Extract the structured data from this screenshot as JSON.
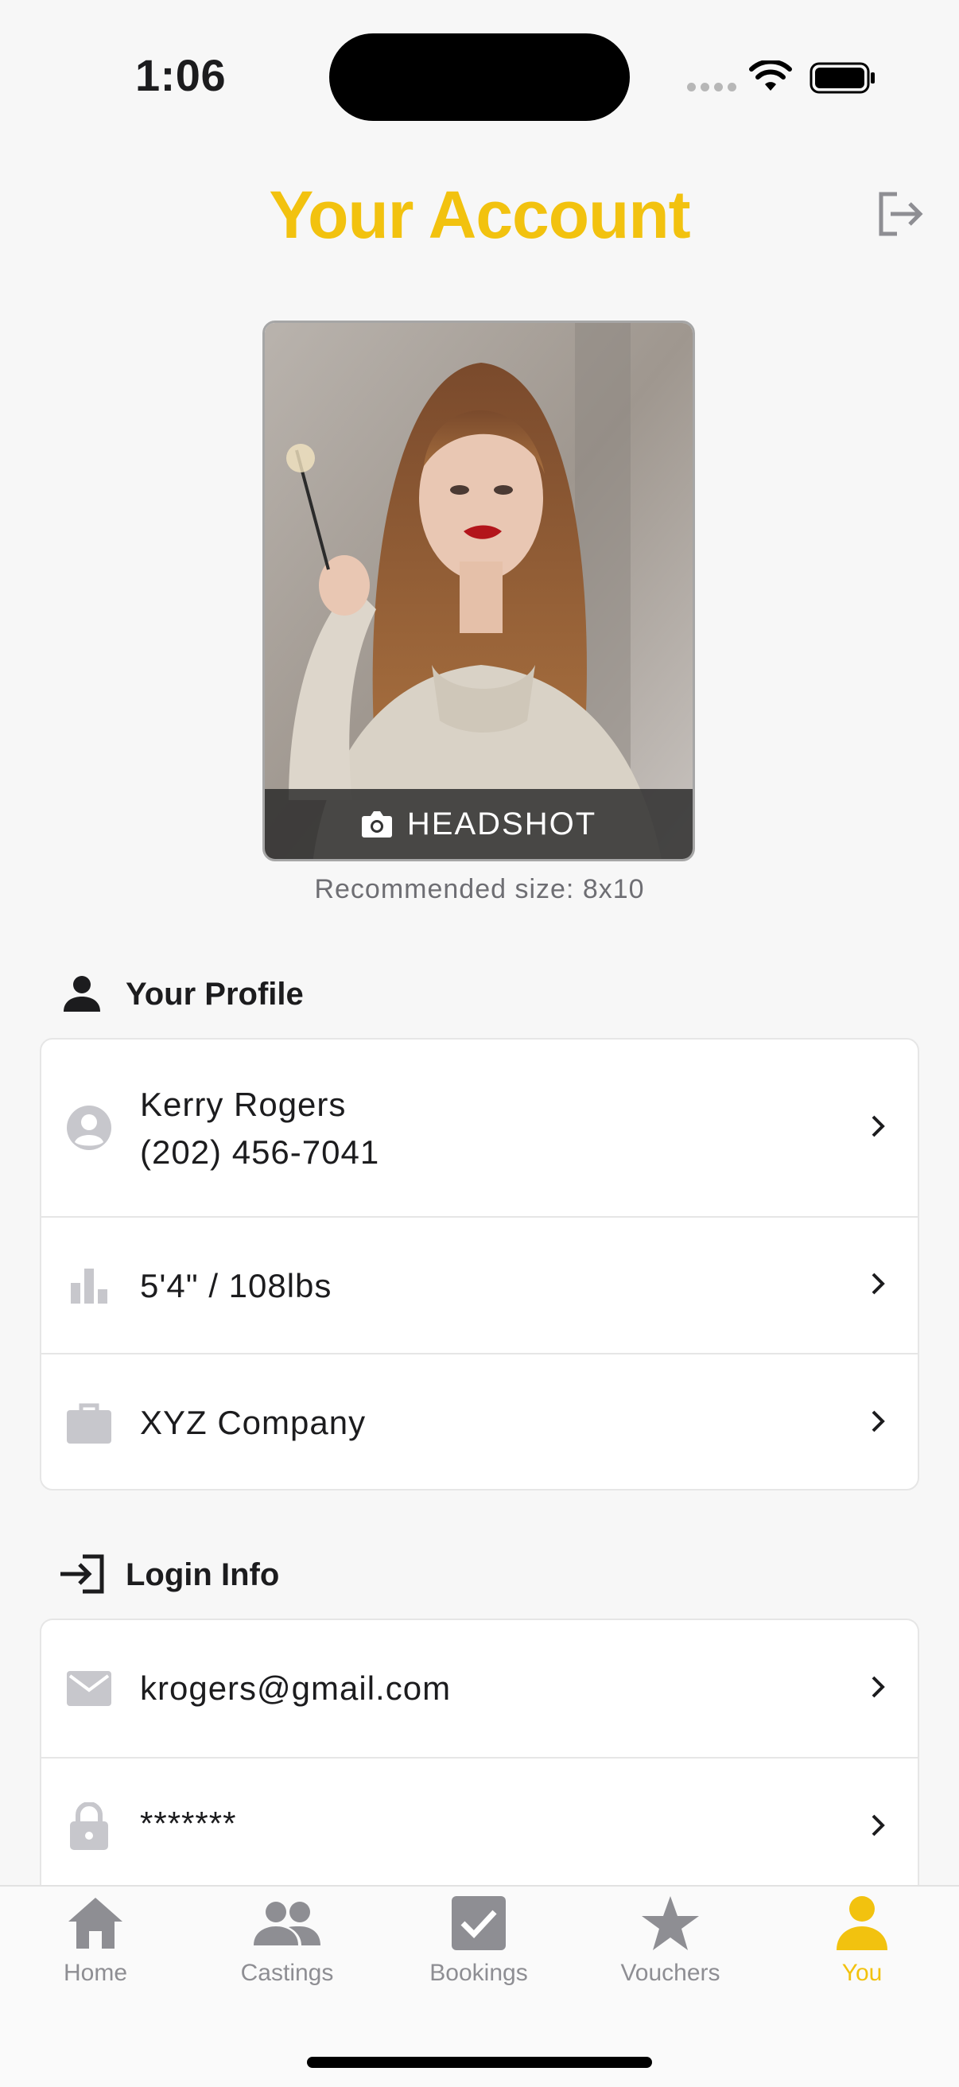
{
  "status_bar": {
    "time": "1:06"
  },
  "header": {
    "title": "Your Account"
  },
  "headshot": {
    "button_label": "HEADSHOT",
    "hint": "Recommended size: 8x10"
  },
  "profile": {
    "section_title": "Your Profile",
    "name": "Kerry Rogers",
    "phone": "(202) 456-7041",
    "measurements": "5'4\" / 108lbs",
    "company": "XYZ Company"
  },
  "login": {
    "section_title": "Login Info",
    "email": "krogers@gmail.com",
    "password": "*******"
  },
  "tabs": [
    {
      "label": "Home",
      "icon": "home-icon"
    },
    {
      "label": "Castings",
      "icon": "people-icon"
    },
    {
      "label": "Bookings",
      "icon": "checkbox-icon"
    },
    {
      "label": "Vouchers",
      "icon": "star-icon"
    },
    {
      "label": "You",
      "icon": "person-icon",
      "active": true
    }
  ],
  "colors": {
    "accent": "#f2c20f",
    "inactive": "#8e8e93",
    "icon_gray": "#c7c7cc"
  }
}
